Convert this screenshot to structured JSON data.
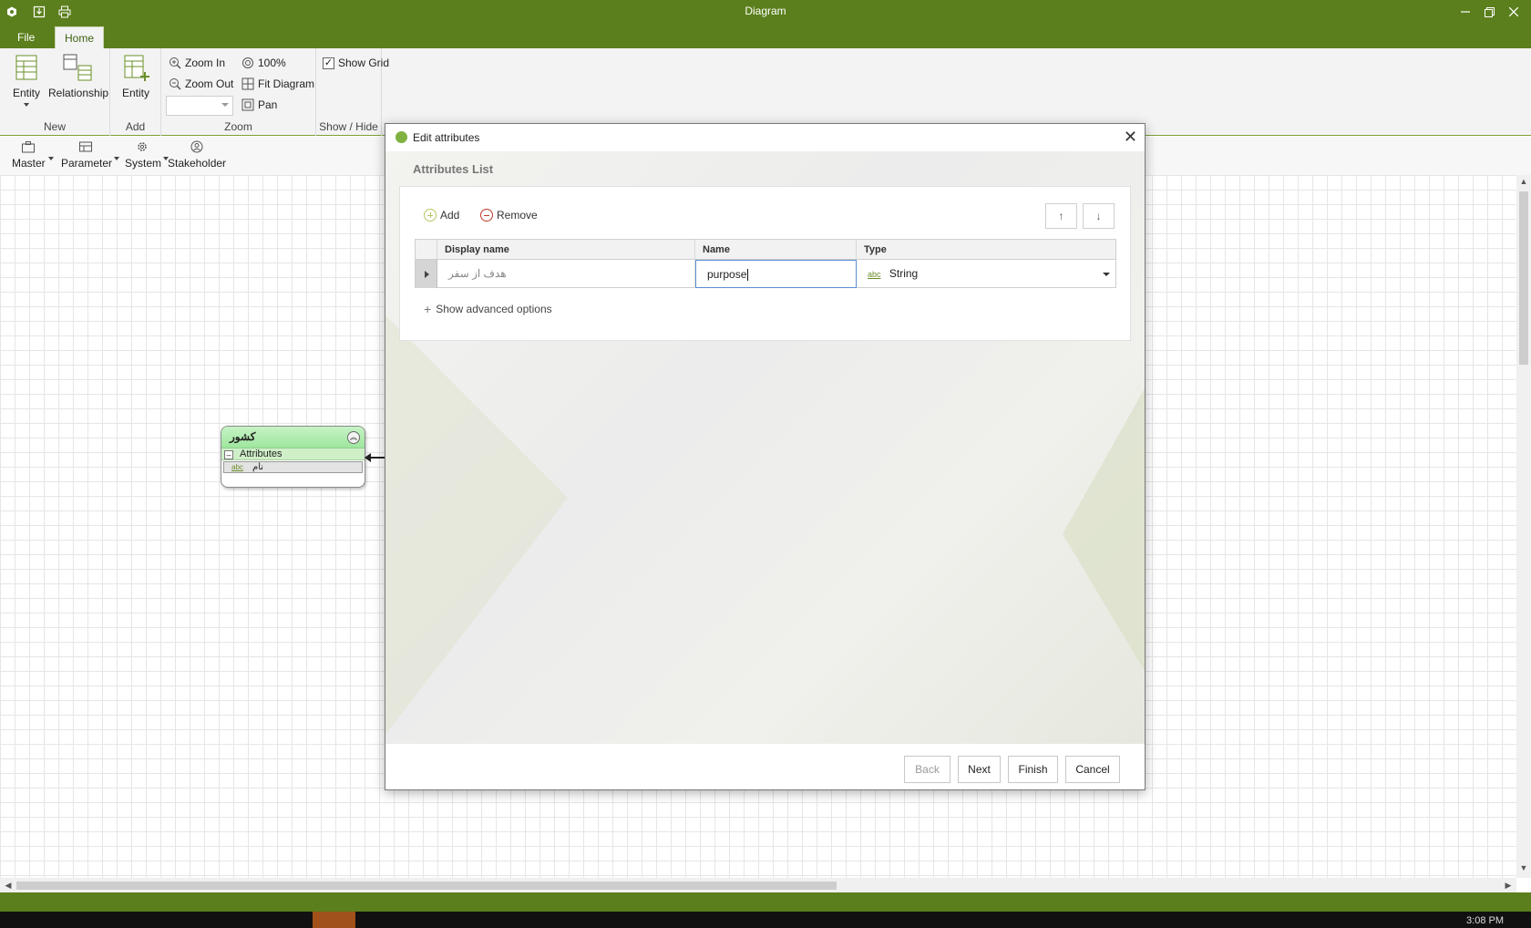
{
  "window": {
    "title": "Diagram",
    "quick_access": [
      "app-icon",
      "save-icon",
      "print-icon"
    ],
    "controls": [
      "minimize-icon",
      "restore-icon",
      "close-icon"
    ]
  },
  "menu_tabs": [
    {
      "label": "File",
      "active": false
    },
    {
      "label": "Home",
      "active": true
    }
  ],
  "ribbon": {
    "groups": {
      "new": {
        "label": "New",
        "entity_label": "Entity",
        "relationship_label": "Relationship"
      },
      "add": {
        "label": "Add",
        "entity_label": "Entity"
      },
      "zoom": {
        "label": "Zoom",
        "zoom_in": "Zoom In",
        "zoom_out": "Zoom Out",
        "zoom_100": "100%",
        "fit_diagram": "Fit Diagram",
        "pan": "Pan",
        "zoom_value": ""
      },
      "show_hide": {
        "label": "Show / Hide",
        "show_grid": "Show Grid",
        "show_grid_checked": true
      }
    }
  },
  "toolbar2": {
    "items": [
      {
        "label": "Master",
        "icon": "briefcase-icon",
        "dropdown": true
      },
      {
        "label": "Parameter",
        "icon": "table-icon",
        "dropdown": true
      },
      {
        "label": "System",
        "icon": "gear-icon",
        "dropdown": true
      },
      {
        "label": "Stakeholder",
        "icon": "person-icon",
        "dropdown": false
      }
    ]
  },
  "entity": {
    "title": "کشور",
    "section_label": "Attributes",
    "attributes": [
      {
        "type": "abc",
        "name": "نام"
      }
    ]
  },
  "dialog": {
    "title": "Edit attributes",
    "section_title": "Attributes List",
    "add_label": "Add",
    "remove_label": "Remove",
    "move_up": "↑",
    "move_down": "↓",
    "columns": [
      "Display name",
      "Name",
      "Type"
    ],
    "rows": [
      {
        "display_name": "هدف از سفر",
        "name": "purpose",
        "type_icon": "abc",
        "type": "String"
      }
    ],
    "advanced_label": "Show advanced options",
    "buttons": {
      "back": "Back",
      "next": "Next",
      "finish": "Finish",
      "cancel": "Cancel"
    }
  },
  "taskbar": {
    "clock": "3:08 PM"
  },
  "colors": {
    "brand_green": "#5b7f1c",
    "entity_header": "#9ee69e",
    "focus_blue": "#5a8fd1"
  }
}
